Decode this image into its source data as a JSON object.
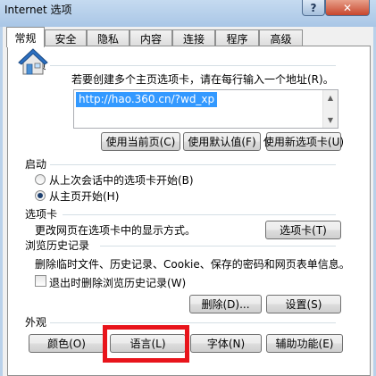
{
  "window": {
    "title": "Internet 选项",
    "help_glyph": "?",
    "close_glyph": "✕"
  },
  "tabs": [
    {
      "label": "常规",
      "active": true
    },
    {
      "label": "安全"
    },
    {
      "label": "隐私"
    },
    {
      "label": "内容"
    },
    {
      "label": "连接"
    },
    {
      "label": "程序"
    },
    {
      "label": "高级"
    }
  ],
  "home": {
    "label": "主页",
    "hint": "若要创建多个主页选项卡，请在每行输入一个地址(R)。",
    "url": "http://hao.360.cn/?wd_xp",
    "use_current": "使用当前页(C)",
    "use_default": "使用默认值(F)",
    "use_new_tab": "使用新选项卡(U)"
  },
  "startup": {
    "label": "启动",
    "option_last": "从上次会话中的选项卡开始(B)",
    "option_home": "从主页开始(H)",
    "selected": "option_home"
  },
  "tabs_section": {
    "label": "选项卡",
    "hint": "更改网页在选项卡中的显示方式。",
    "button": "选项卡(T)"
  },
  "history": {
    "label": "浏览历史记录",
    "hint": "删除临时文件、历史记录、Cookie、保存的密码和网页表单信息。",
    "delete_on_exit": "退出时删除浏览历史记录(W)",
    "delete_on_exit_checked": false,
    "delete_button": "删除(D)...",
    "settings_button": "设置(S)"
  },
  "appearance": {
    "label": "外观",
    "colors": "颜色(O)",
    "languages": "语言(L)",
    "fonts": "字体(N)",
    "accessibility": "辅助功能(E)"
  },
  "colors": {
    "highlight": "#e8141b",
    "selection": "#3399ff"
  }
}
